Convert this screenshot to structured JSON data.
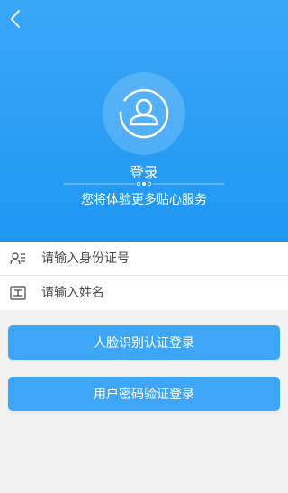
{
  "header": {
    "back_icon": "chevron-left-icon",
    "avatar_icon": "user-avatar-icon",
    "title": "登录",
    "subtitle": "您将体验更多贴心服务"
  },
  "form": {
    "id_field": {
      "icon": "id-card-icon",
      "placeholder": "请输入身份证号"
    },
    "name_field": {
      "icon": "name-card-icon",
      "placeholder": "请输入姓名"
    }
  },
  "buttons": {
    "face_login": "人脸识别认证登录",
    "password_login": "用户密码验证登录"
  },
  "colors": {
    "primary": "#1e97f3",
    "button": "#3ea6f6",
    "background": "#f2f2f2"
  }
}
